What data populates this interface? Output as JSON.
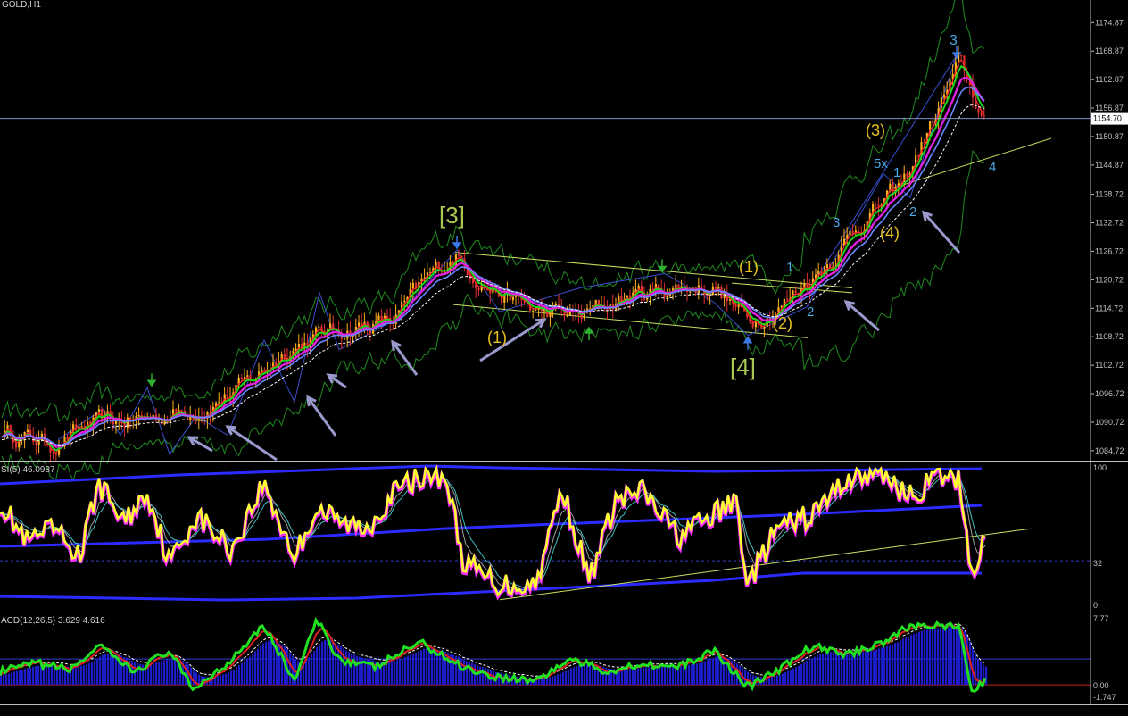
{
  "window": {
    "symbol_label": "GOLD,H1"
  },
  "colors": {
    "background": "#000000",
    "axis": "#c0c0c0",
    "bull_candle": "#ffb01e",
    "bear_candle": "#e23030",
    "ma_fast": "#ff2a2a",
    "ma_green": "#1ed21e",
    "ma_magenta": "#e020e0",
    "ma_blue": "#6a88ff",
    "bollinger": "#1f8a1f",
    "channel": "#c8e060",
    "wave_blue": "#3a4fd0",
    "arrow": "#9a9acf",
    "yellow_label": "#e8c020",
    "green_label": "#a8c850",
    "cyan_label": "#4aa8e8",
    "rsi_main": "#ffff30",
    "rsi_shadow": "#ff30ff",
    "rsi_band": "#2b2bff",
    "macd_hist": "#1c1cc8",
    "macd_line": "#20e020",
    "macd_signal": "#e02020"
  },
  "chart_data": [
    {
      "type": "line",
      "panel": "price",
      "ylim": [
        1083.0,
        1178.5
      ],
      "ticks": [
        "1174.87",
        "1168.87",
        "1162.87",
        "1156.87",
        "1150.87",
        "1144.87",
        "1138.72",
        "1132.72",
        "1126.72",
        "1120.72",
        "1114.72",
        "1108.72",
        "1102.72",
        "1096.72",
        "1090.72",
        "1084.72"
      ],
      "current_price_label": "1154.70",
      "current_price": 1154.7,
      "x": [
        0,
        60,
        100,
        140,
        180,
        230,
        280,
        320,
        355,
        400,
        440,
        480,
        510,
        550,
        600,
        650,
        700,
        750,
        800,
        838,
        880,
        930,
        970,
        1010,
        1040,
        1075,
        1105
      ],
      "series": [
        {
          "values": [
            1089.0,
            1086.0,
            1090.0,
            1091.0,
            1092.0,
            1094.0,
            1099.0,
            1106.0,
            1109.0,
            1111.0,
            1112.0,
            1121.0,
            1126.0,
            1119.0,
            1114.0,
            1113.0,
            1117.0,
            1119.0,
            1119.5,
            1112.0,
            1116.0,
            1125.0,
            1134.0,
            1140.0,
            1152.0,
            1166.0,
            1153.0
          ]
        }
      ],
      "wave_labels": [
        "[3]",
        "[4]",
        "(1)",
        "(1)",
        "(2)",
        "(3)",
        "(4)",
        "1",
        "2",
        "3",
        "5x",
        "1",
        "2",
        "3",
        "4"
      ]
    },
    {
      "type": "line",
      "panel": "rsi",
      "title": "SI(5) 46.0987",
      "ylim": [
        0,
        100
      ],
      "ticks": [
        "100",
        "32",
        "0"
      ],
      "level": 32,
      "x": [
        0,
        30,
        60,
        90,
        110,
        140,
        165,
        190,
        220,
        260,
        295,
        330,
        355,
        380,
        410,
        440,
        475,
        500,
        520,
        560,
        600,
        630,
        660,
        690,
        720,
        760,
        800,
        825,
        838,
        870,
        910,
        950,
        990,
        1020,
        1050,
        1075,
        1090,
        1100
      ],
      "series": [
        {
          "values": [
            75,
            45,
            55,
            35,
            88,
            60,
            82,
            30,
            65,
            40,
            88,
            35,
            70,
            60,
            55,
            80,
            95,
            92,
            30,
            15,
            15,
            85,
            18,
            75,
            82,
            50,
            65,
            75,
            15,
            55,
            65,
            92,
            95,
            78,
            92,
            90,
            20,
            45
          ]
        }
      ]
    },
    {
      "type": "line",
      "panel": "macd",
      "title": "ACD(12,26,5) 3.629 4.616",
      "ylim": [
        -1.747,
        7.77
      ],
      "ticks": [
        "7.77",
        "0.00",
        "-1.747"
      ],
      "x": [
        0,
        40,
        80,
        110,
        150,
        190,
        215,
        250,
        295,
        330,
        355,
        380,
        420,
        470,
        510,
        550,
        600,
        640,
        680,
        720,
        760,
        800,
        838,
        870,
        910,
        950,
        990,
        1020,
        1050,
        1075,
        1090,
        1105
      ],
      "series": [
        {
          "name": "macd",
          "values": [
            1.5,
            2.5,
            1.8,
            4.5,
            1.5,
            4.0,
            -0.5,
            2.0,
            7.0,
            0.5,
            7.5,
            3.0,
            2.0,
            5.0,
            2.5,
            1.0,
            0.5,
            3.0,
            1.5,
            2.5,
            2.0,
            4.0,
            -0.2,
            1.5,
            4.5,
            3.5,
            5.0,
            6.8,
            7.0,
            6.5,
            -1.2,
            0.8
          ]
        }
      ]
    }
  ]
}
